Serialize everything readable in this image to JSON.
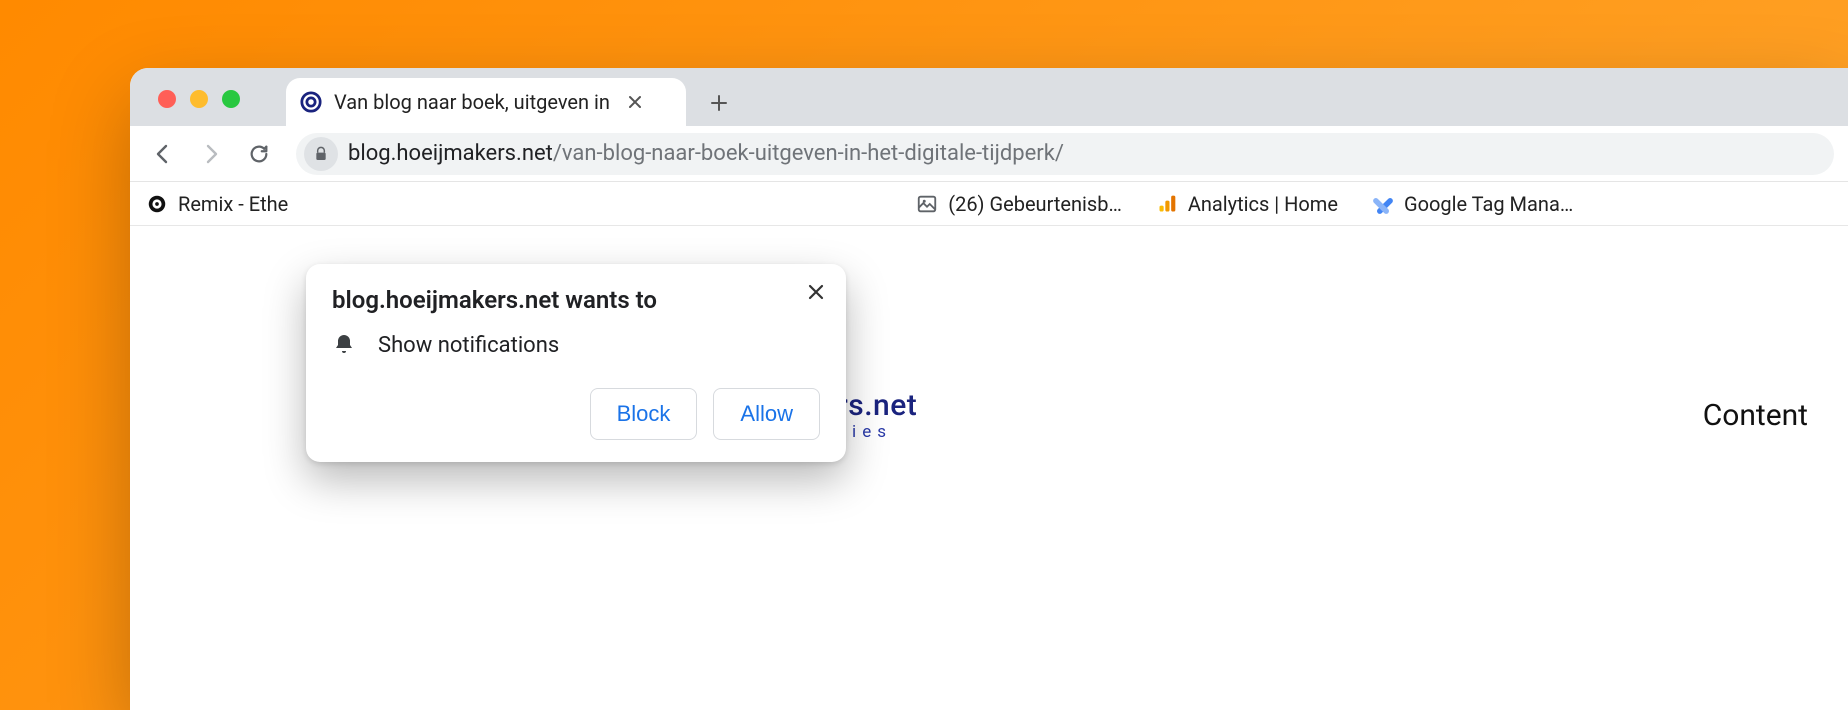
{
  "tab": {
    "title": "Van blog naar boek, uitgeven in"
  },
  "url": {
    "host": "blog.hoeijmakers.net",
    "path": "/van-blog-naar-boek-uitgeven-in-het-digitale-tijdperk/"
  },
  "bookmarks": [
    {
      "label": "Remix - Ethe"
    },
    {
      "label": "(26) Gebeurtenisb…"
    },
    {
      "label": "Analytics | Home"
    },
    {
      "label": "Google Tag Mana…"
    }
  ],
  "site": {
    "brand_title": "hoeijmakers.net",
    "brand_sub": "Web Strategies",
    "nav_content": "Content"
  },
  "popup": {
    "title": "blog.hoeijmakers.net wants to",
    "row_text": "Show notifications",
    "block_label": "Block",
    "allow_label": "Allow"
  }
}
